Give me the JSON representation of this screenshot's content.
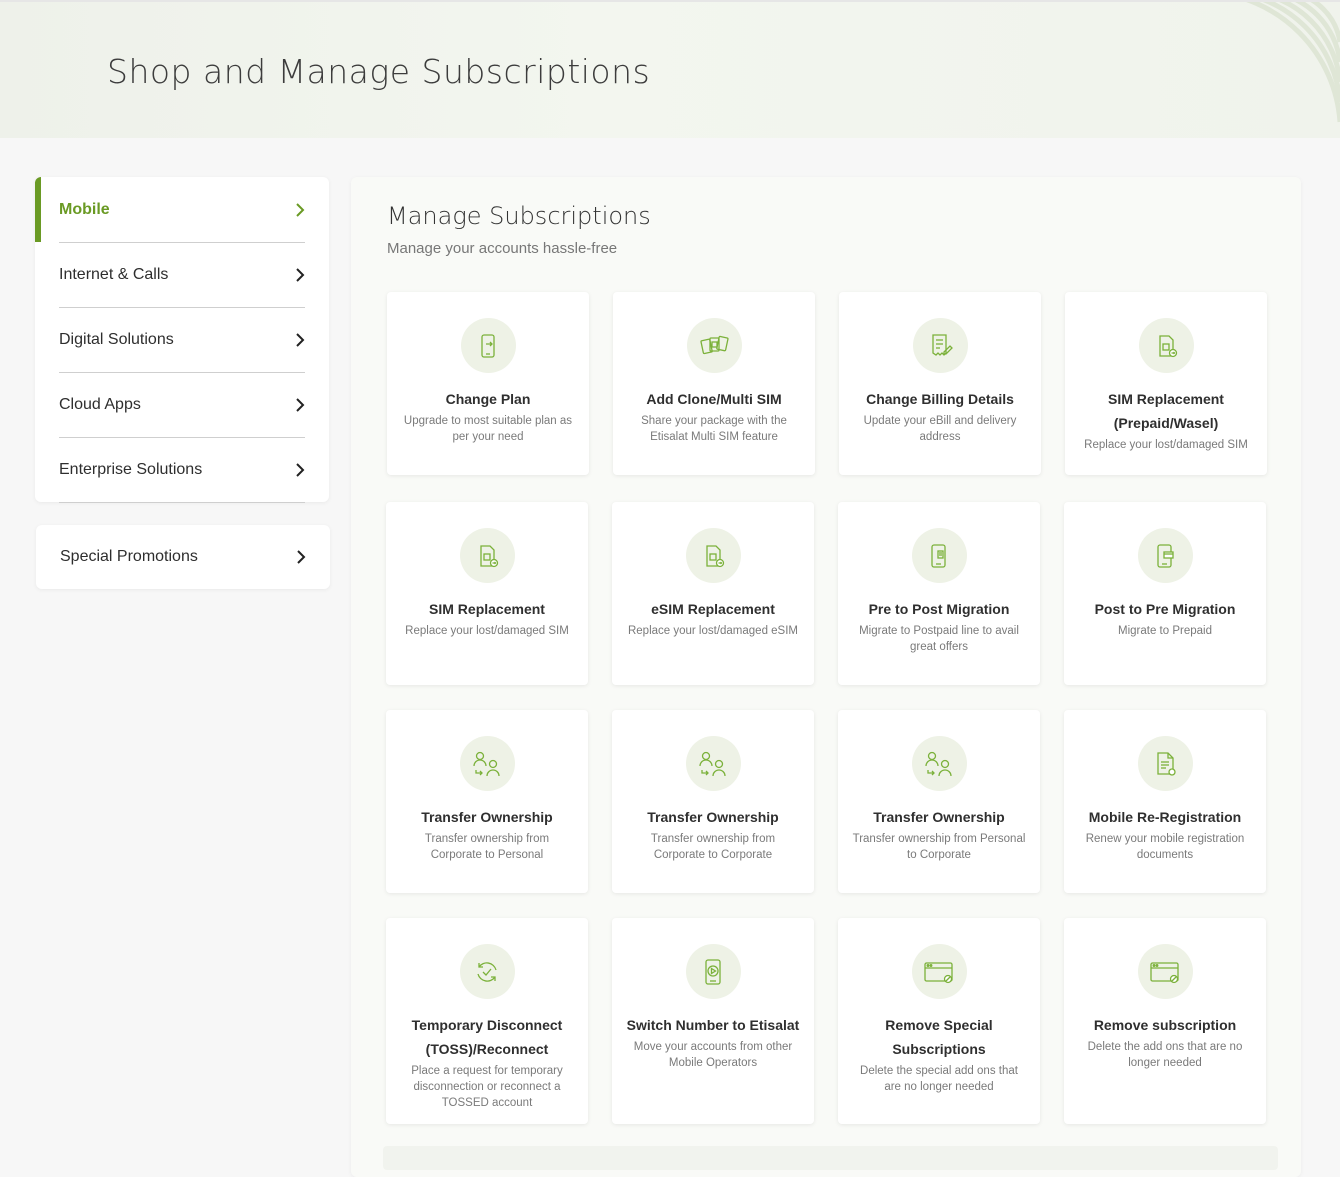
{
  "header": {
    "title": "Shop and Manage Subscriptions"
  },
  "nav": {
    "items": [
      {
        "label": "Mobile",
        "active": true,
        "icon": "chevron-right-icon"
      },
      {
        "label": "Internet & Calls",
        "icon": "chevron-right-icon"
      },
      {
        "label": "Digital Solutions",
        "icon": "chevron-right-icon"
      },
      {
        "label": "Cloud Apps",
        "icon": "chevron-right-icon"
      },
      {
        "label": "Enterprise Solutions",
        "icon": "chevron-right-icon"
      }
    ],
    "promo": {
      "label": "Special Promotions",
      "icon": "chevron-right-icon"
    }
  },
  "main": {
    "title": "Manage Subscriptions",
    "subtitle": "Manage your accounts hassle-free",
    "tiles": [
      {
        "title": "Change Plan",
        "desc": "Upgrade to most suitable plan as per your need",
        "icon": "phone-swap-icon"
      },
      {
        "title": "Add Clone/Multi SIM",
        "desc": "Share your package with the Etisalat Multi SIM feature",
        "icon": "multi-sim-icon"
      },
      {
        "title": "Change Billing Details",
        "desc": "Update your eBill and delivery address",
        "icon": "bill-edit-icon"
      },
      {
        "title": "SIM Replacement (Prepaid/Wasel)",
        "desc": "Replace your lost/damaged SIM",
        "icon": "sim-replace-icon"
      },
      {
        "title": "SIM Replacement",
        "desc": "Replace your lost/damaged SIM",
        "icon": "sim-replace-icon"
      },
      {
        "title": "eSIM Replacement",
        "desc": "Replace your lost/damaged eSIM",
        "icon": "esim-replace-icon"
      },
      {
        "title": "Pre to Post Migration",
        "desc": "Migrate to Postpaid line to avail great offers",
        "icon": "phone-migrate-icon"
      },
      {
        "title": "Post to Pre Migration",
        "desc": "Migrate to Prepaid",
        "icon": "phone-card-icon"
      },
      {
        "title": "Transfer Ownership",
        "desc": "Transfer ownership from Corporate to Personal",
        "icon": "users-transfer-icon"
      },
      {
        "title": "Transfer Ownership",
        "desc": "Transfer ownership from Corporate to Corporate",
        "icon": "users-transfer-icon"
      },
      {
        "title": "Transfer Ownership",
        "desc": "Transfer ownership from Personal to Corporate",
        "icon": "users-transfer-icon"
      },
      {
        "title": "Mobile Re-Registration",
        "desc": "Renew your mobile registration documents",
        "icon": "document-renew-icon"
      },
      {
        "title": "Temporary Disconnect (TOSS)/Reconnect",
        "desc": "Place a request for temporary disconnection or reconnect a TOSSED account",
        "icon": "refresh-check-icon"
      },
      {
        "title": "Switch Number to Etisalat",
        "desc": "Move your accounts from other Mobile Operators",
        "icon": "phone-switch-icon"
      },
      {
        "title": "Remove Special Subscriptions",
        "desc": "Delete the special add ons that are no longer needed",
        "icon": "browser-remove-icon"
      },
      {
        "title": "Remove subscription",
        "desc": "Delete the add ons that are no longer needed",
        "icon": "browser-remove-icon"
      }
    ]
  },
  "colors": {
    "accent": "#6a9a24",
    "icon_bg": "#eef2e6",
    "icon_stroke": "#7bb13a"
  }
}
